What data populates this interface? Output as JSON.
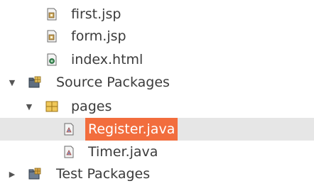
{
  "tree": {
    "items": [
      {
        "label": "first.jsp",
        "icon": "jsp-file-icon"
      },
      {
        "label": "form.jsp",
        "icon": "jsp-file-icon"
      },
      {
        "label": "index.html",
        "icon": "html-file-icon"
      },
      {
        "label": "Source Packages",
        "icon": "source-packages-icon",
        "expanded": true
      },
      {
        "label": "pages",
        "icon": "package-icon",
        "expanded": true
      },
      {
        "label": "Register.java",
        "icon": "java-file-icon",
        "selected": true
      },
      {
        "label": "Timer.java",
        "icon": "java-file-icon"
      },
      {
        "label": "Test Packages",
        "icon": "test-packages-icon",
        "expanded": false
      }
    ]
  },
  "colors": {
    "selection_label_bg": "#f26d3d",
    "selection_row_bg": "#e6e6e6",
    "text": "#3b3b3b"
  }
}
